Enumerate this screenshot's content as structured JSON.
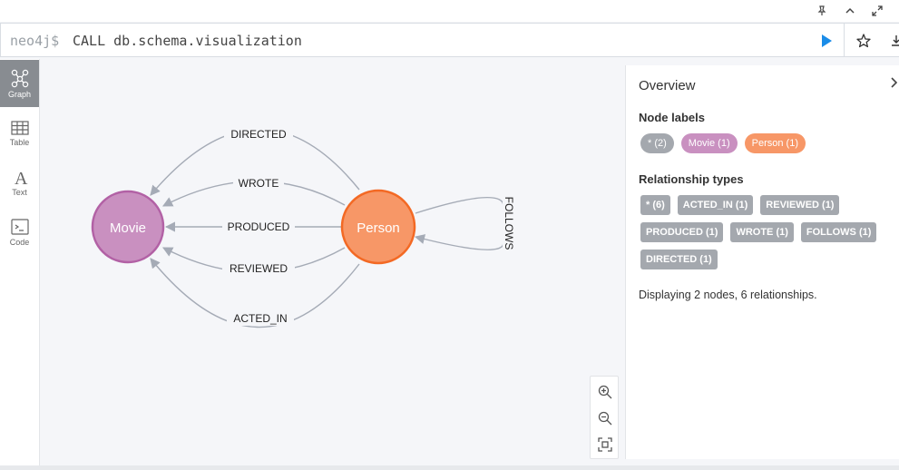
{
  "window": {
    "icons": [
      "pin-icon",
      "chevron-up-icon",
      "expand-icon"
    ]
  },
  "editor": {
    "prompt": "neo4j$",
    "query": "CALL db.schema.visualization",
    "run_icon": "play-icon",
    "favorite_icon": "star-icon",
    "save_icon": "download-icon",
    "colors": {
      "run": "#1a8ce8"
    }
  },
  "sidebar": {
    "items": [
      {
        "label": "Graph",
        "icon": "graph-icon",
        "active": true
      },
      {
        "label": "Table",
        "icon": "table-icon",
        "active": false
      },
      {
        "label": "Text",
        "icon": "text-icon",
        "active": false
      },
      {
        "label": "Code",
        "icon": "code-icon",
        "active": false
      }
    ]
  },
  "graph": {
    "nodes": [
      {
        "label": "Movie",
        "fill": "#c990c0",
        "stroke": "#b261a5"
      },
      {
        "label": "Person",
        "fill": "#f79767",
        "stroke": "#f36924"
      }
    ],
    "relationships": [
      "DIRECTED",
      "WROTE",
      "PRODUCED",
      "REVIEWED",
      "ACTED_IN",
      "FOLLOWS"
    ]
  },
  "zoom": {
    "icons": [
      "zoom-in-icon",
      "zoom-out-icon",
      "fit-icon"
    ]
  },
  "overview": {
    "title": "Overview",
    "node_labels_heading": "Node labels",
    "node_labels": [
      {
        "text": "* (2)",
        "color": "#a4a8ae"
      },
      {
        "text": "Movie (1)",
        "color": "#c990c0"
      },
      {
        "text": "Person (1)",
        "color": "#f79767"
      }
    ],
    "relationship_types_heading": "Relationship types",
    "relationship_types": [
      "* (6)",
      "ACTED_IN (1)",
      "REVIEWED (1)",
      "PRODUCED (1)",
      "WROTE (1)",
      "FOLLOWS (1)",
      "DIRECTED (1)"
    ],
    "summary": "Displaying 2 nodes, 6 relationships."
  }
}
